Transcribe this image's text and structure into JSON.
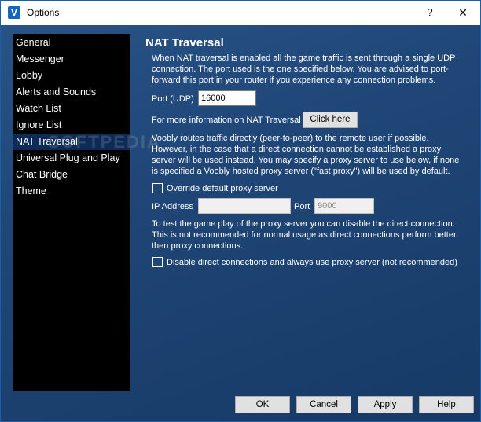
{
  "window": {
    "title": "Options",
    "help_symbol": "?",
    "close_symbol": "✕",
    "app_icon_letter": "V"
  },
  "sidebar": {
    "items": [
      {
        "label": "General"
      },
      {
        "label": "Messenger"
      },
      {
        "label": "Lobby"
      },
      {
        "label": "Alerts and Sounds"
      },
      {
        "label": "Watch List"
      },
      {
        "label": "Ignore List"
      },
      {
        "label": "NAT Traversal",
        "selected": true
      },
      {
        "label": "Universal Plug and Play"
      },
      {
        "label": "Chat Bridge"
      },
      {
        "label": "Theme"
      }
    ]
  },
  "watermark": "SOFTPEDIA",
  "panel": {
    "heading": "NAT Traversal",
    "intro_text": "When NAT traversal is enabled all the game traffic is sent through a single UDP connection. The port used is the one specified below. You are advised to port-forward this port in your router if you experience any connection problems.",
    "port_label": "Port (UDP)",
    "port_value": "16000",
    "more_info_text": "For more information on NAT Traversal",
    "click_here_label": "Click here",
    "proxy_text": "Voobly routes traffic directly (peer-to-peer) to the remote user if possible. However, in the case that a direct connection cannot be established a proxy server will be used instead. You may specify a proxy server to use below, if none is specified a Voobly hosted proxy server (\"fast proxy\") will be used by default.",
    "override_proxy_label": "Override default proxy server",
    "override_proxy_checked": false,
    "ip_label": "IP Address",
    "ip_value": "",
    "proxy_port_label": "Port",
    "proxy_port_value": "9000",
    "test_text": "To test the game play of the proxy server you can disable the direct connection. This is not recommended for normal usage as direct connections perform better then proxy connections.",
    "disable_direct_label": "Disable direct connections and always use proxy server (not recommended)",
    "disable_direct_checked": false
  },
  "footer": {
    "ok_label": "OK",
    "cancel_label": "Cancel",
    "apply_label": "Apply",
    "help_label": "Help"
  }
}
